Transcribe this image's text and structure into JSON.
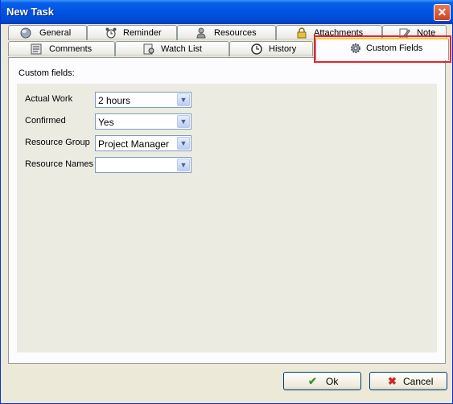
{
  "window": {
    "title": "New Task"
  },
  "tabs": {
    "row1": [
      {
        "label": "General",
        "icon": "globe-icon"
      },
      {
        "label": "Reminder",
        "icon": "alarm-clock-icon"
      },
      {
        "label": "Resources",
        "icon": "person-icon"
      },
      {
        "label": "Attachments",
        "icon": "padlock-icon"
      },
      {
        "label": "Note",
        "icon": "note-pencil-icon"
      }
    ],
    "row2": [
      {
        "label": "Comments",
        "icon": "comments-icon"
      },
      {
        "label": "Watch List",
        "icon": "watch-list-icon"
      },
      {
        "label": "History",
        "icon": "history-icon"
      },
      {
        "label": "Custom Fields",
        "icon": "gear-icon",
        "selected": true
      }
    ]
  },
  "panel": {
    "caption": "Custom fields:"
  },
  "fields": [
    {
      "label": "Actual Work",
      "value": "2 hours"
    },
    {
      "label": "Confirmed",
      "value": "Yes"
    },
    {
      "label": "Resource Group",
      "value": "Project Manager"
    },
    {
      "label": "Resource Names",
      "value": ""
    }
  ],
  "buttons": {
    "ok": {
      "label": "Ok",
      "icon": "check-icon"
    },
    "cancel": {
      "label": "Cancel",
      "icon": "x-icon"
    }
  },
  "colors": {
    "titlebar": "#0054e3",
    "highlight_box": "#e8232a",
    "ok_icon": "#2e9a2a",
    "cancel_icon": "#d42222"
  }
}
